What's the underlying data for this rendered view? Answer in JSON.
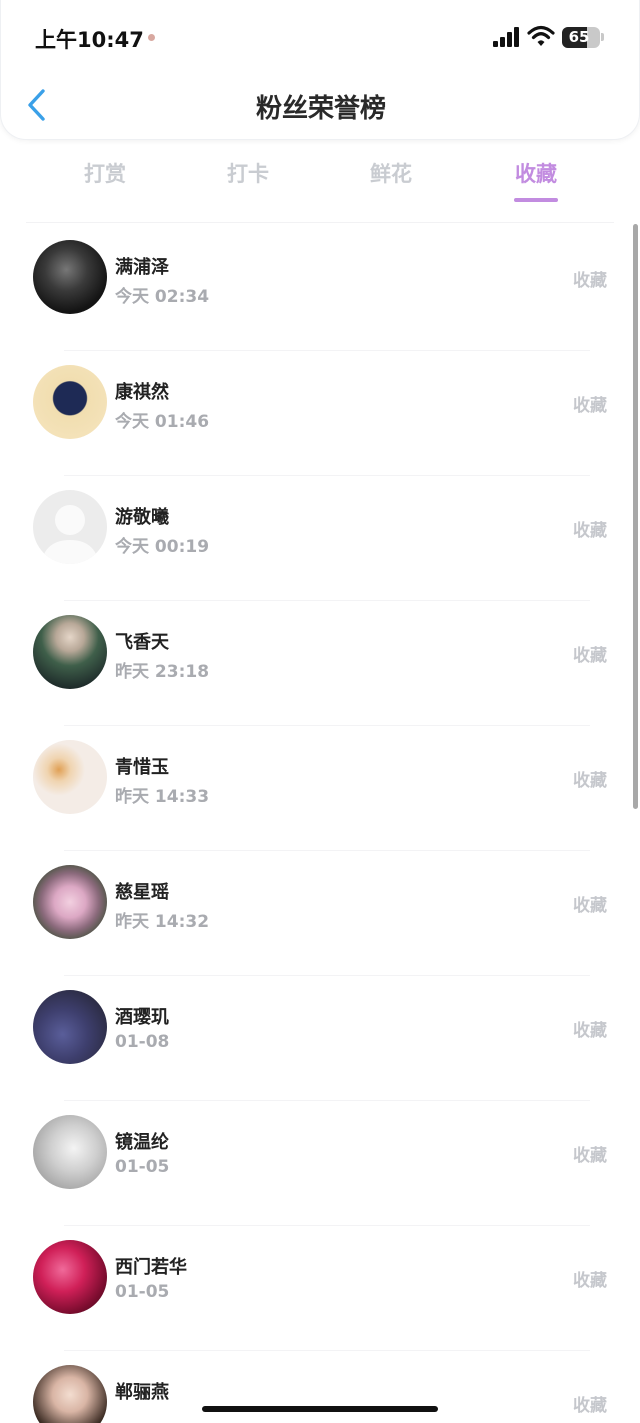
{
  "status_bar": {
    "time": "上午10:47",
    "battery": "65",
    "battery_level": 0.65
  },
  "header": {
    "title": "粉丝荣誉榜"
  },
  "tabs": [
    {
      "label": "打赏",
      "active": false
    },
    {
      "label": "打卡",
      "active": false
    },
    {
      "label": "鲜花",
      "active": false
    },
    {
      "label": "收藏",
      "active": true
    }
  ],
  "fans": [
    {
      "name": "满浦泽",
      "time": "今天 02:34",
      "action": "收藏"
    },
    {
      "name": "康祺然",
      "time": "今天 01:46",
      "action": "收藏"
    },
    {
      "name": "游敬曦",
      "time": "今天 00:19",
      "action": "收藏"
    },
    {
      "name": "飞香天",
      "time": "昨天 23:18",
      "action": "收藏"
    },
    {
      "name": "青惜玉",
      "time": "昨天 14:33",
      "action": "收藏"
    },
    {
      "name": "慈星瑶",
      "time": "昨天 14:32",
      "action": "收藏"
    },
    {
      "name": "酒璎玑",
      "time": "01-08",
      "action": "收藏"
    },
    {
      "name": "镜温纶",
      "time": "01-05",
      "action": "收藏"
    },
    {
      "name": "西门若华",
      "time": "01-05",
      "action": "收藏"
    },
    {
      "name": "郸骊燕",
      "time": "",
      "action": "收藏"
    }
  ],
  "colors": {
    "accent": "#c28ce0",
    "back_arrow": "#3aa0e8",
    "inactive_tab": "#c9ccd1"
  }
}
